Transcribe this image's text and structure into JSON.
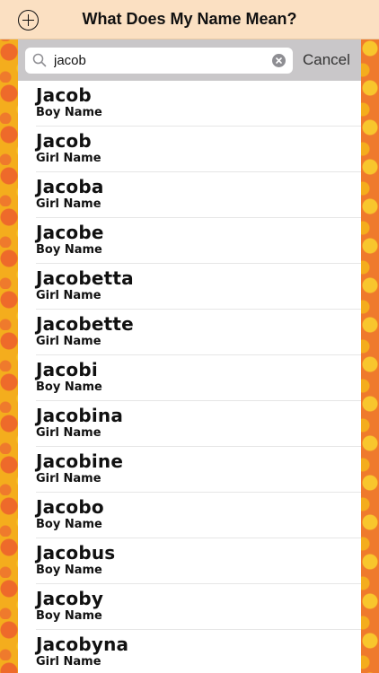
{
  "nav": {
    "title": "What Does My Name Mean?",
    "add_icon": "plus-circle-icon"
  },
  "search": {
    "value": "jacob",
    "placeholder": "Search",
    "cancel_label": "Cancel",
    "search_icon": "magnifier-icon",
    "clear_icon": "clear-x-icon"
  },
  "results": [
    {
      "name": "Jacob",
      "gender": "Boy Name"
    },
    {
      "name": "Jacob",
      "gender": "Girl Name"
    },
    {
      "name": "Jacoba",
      "gender": "Girl Name"
    },
    {
      "name": "Jacobe",
      "gender": "Boy Name"
    },
    {
      "name": "Jacobetta",
      "gender": "Girl Name"
    },
    {
      "name": "Jacobette",
      "gender": "Girl Name"
    },
    {
      "name": "Jacobi",
      "gender": "Boy Name"
    },
    {
      "name": "Jacobina",
      "gender": "Girl Name"
    },
    {
      "name": "Jacobine",
      "gender": "Girl Name"
    },
    {
      "name": "Jacobo",
      "gender": "Boy Name"
    },
    {
      "name": "Jacobus",
      "gender": "Boy Name"
    },
    {
      "name": "Jacoby",
      "gender": "Boy Name"
    },
    {
      "name": "Jacobyna",
      "gender": "Girl Name"
    }
  ]
}
